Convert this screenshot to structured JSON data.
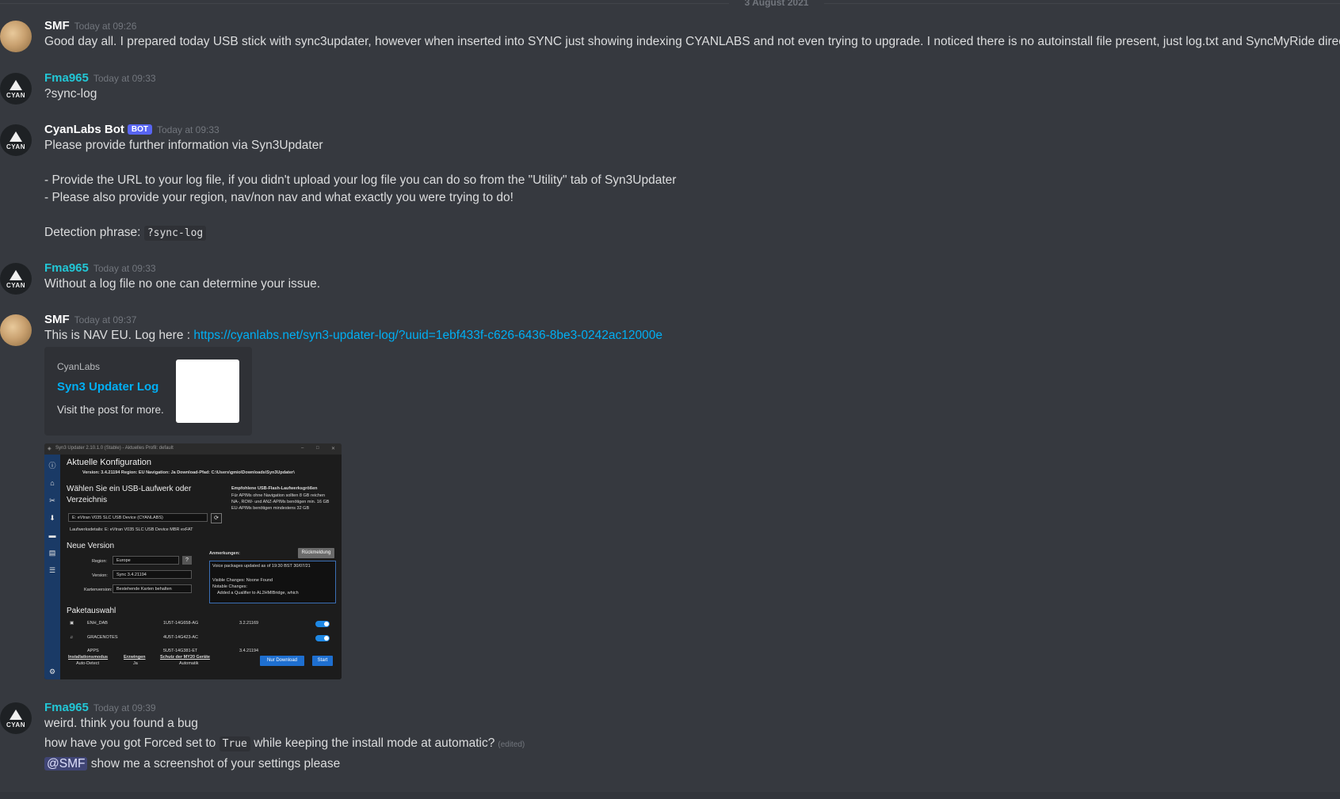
{
  "date_divider": "3 August 2021",
  "messages": [
    {
      "author": "SMF",
      "timestamp": "Today at 09:26",
      "lines": [
        "Good day all. I prepared today USB stick with sync3updater, however when inserted into SYNC just showing indexing CYANLABS and not even trying to upgrade. I noticed there is no autoinstall file present, just log.txt and SyncMyRide directory."
      ]
    },
    {
      "author": "Fma965",
      "timestamp": "Today at 09:33",
      "lines": [
        "?sync-log"
      ]
    },
    {
      "author": "CyanLabs Bot",
      "bot_tag": "BOT",
      "timestamp": "Today at 09:33",
      "lines": [
        "Please provide further information via Syn3Updater",
        "- Provide the URL to your log file, if you didn't upload your log file you can do so from the \"Utility\" tab of Syn3Updater",
        "- Please also provide your region, nav/non nav and what exactly you were trying to do!"
      ],
      "detection_label": "Detection phrase:",
      "detection_code": "?sync-log"
    },
    {
      "author": "Fma965",
      "timestamp": "Today at 09:33",
      "lines": [
        "Without a log file no one can determine your issue."
      ]
    },
    {
      "author": "SMF",
      "timestamp": "Today at 09:37",
      "text_prefix": "This is NAV EU. Log here : ",
      "link": "https://cyanlabs.net/syn3-updater-log/?uuid=1ebf433f-c626-6436-8be3-0242ac12000e",
      "embed": {
        "provider": "CyanLabs",
        "title": "Syn3 Updater Log",
        "description": "Visit the post for more."
      }
    },
    {
      "author": "Fma965",
      "timestamp": "Today at 09:39",
      "line1": "weird. think you found a bug",
      "line2_prefix": "how have you got Forced set to ",
      "line2_code": "True",
      "line2_suffix": " while keeping the install mode at automatic?",
      "edited": "(edited)",
      "mention": "@SMF",
      "line3_suffix": " show me a screenshot of your settings please"
    }
  ],
  "attachment": {
    "window_title": "Syn3 Updater 2.10.1.0 (Stable) - Aktuelles Profil: default",
    "current_config": "Aktuelle Konfiguration",
    "config_line": "Version:  3.4.21194    Region:  EU    Navigation:  Ja    Download-Pfad:  C:\\Users\\gmio\\Downloads\\Syn3Updater\\",
    "usb_heading": "Wählen Sie ein USB-Laufwerk oder",
    "usb_heading2": "Verzeichnis",
    "usb_recommend_title": "Empfohlene USB-Flash-Laufwerksgrößen",
    "usb_recommend_1": "Für APIMs ohne Navigation sollten 8 GB reichen",
    "usb_recommend_2": "NA-, ROW- und ANZ-APIMs benötigen min. 16 GB",
    "usb_recommend_3": "EU-APIMs benötigen mindestens 32 GB",
    "usb_drive": "E: eVtran V035 SLC USB Device (CYANLABS)",
    "drive_details": "Laufwerksdetails:  E: eVtran V035 SLC USB Device MBR exFAT",
    "new_version": "Neue Version",
    "region_label": "Region:",
    "region_value": "Europe",
    "version_label": "Version:",
    "version_value": "Sync 3.4.21194",
    "maps_label": "Kartenversion:",
    "maps_value": "Bestehende Karten behalten",
    "notes_label": "Anmerkungen:",
    "feedback_button": "Rückmeldung",
    "notes_1": "Voice packages updated as of 19:30 BST 30/07/21",
    "notes_2": "Visible Changes: Noone Found",
    "notes_3": "Notable Changes:",
    "notes_4": "Added a Qualifier to AL2HMIBridge, which",
    "packages_heading": "Paketauswahl",
    "packages": [
      {
        "name": "ENH_DAB",
        "part": "1U5T-14G658-AG",
        "version": "3.2.21169"
      },
      {
        "name": "GRACENOTES",
        "part": "4U5T-14G423-AC",
        "version": ""
      },
      {
        "name": "APPS",
        "part": "5U5T-14G381-ET",
        "version": "3.4.21194"
      }
    ],
    "install_mode_label": "Installationsmodus",
    "install_mode_value": "Auto-Detect",
    "force_label": "Erzwingen",
    "force_value": "Ja",
    "my20_label": "Schutz der MY20 Geräte",
    "my20_value": "Automatik",
    "download_only_button": "Nur Download",
    "start_button": "Start"
  }
}
